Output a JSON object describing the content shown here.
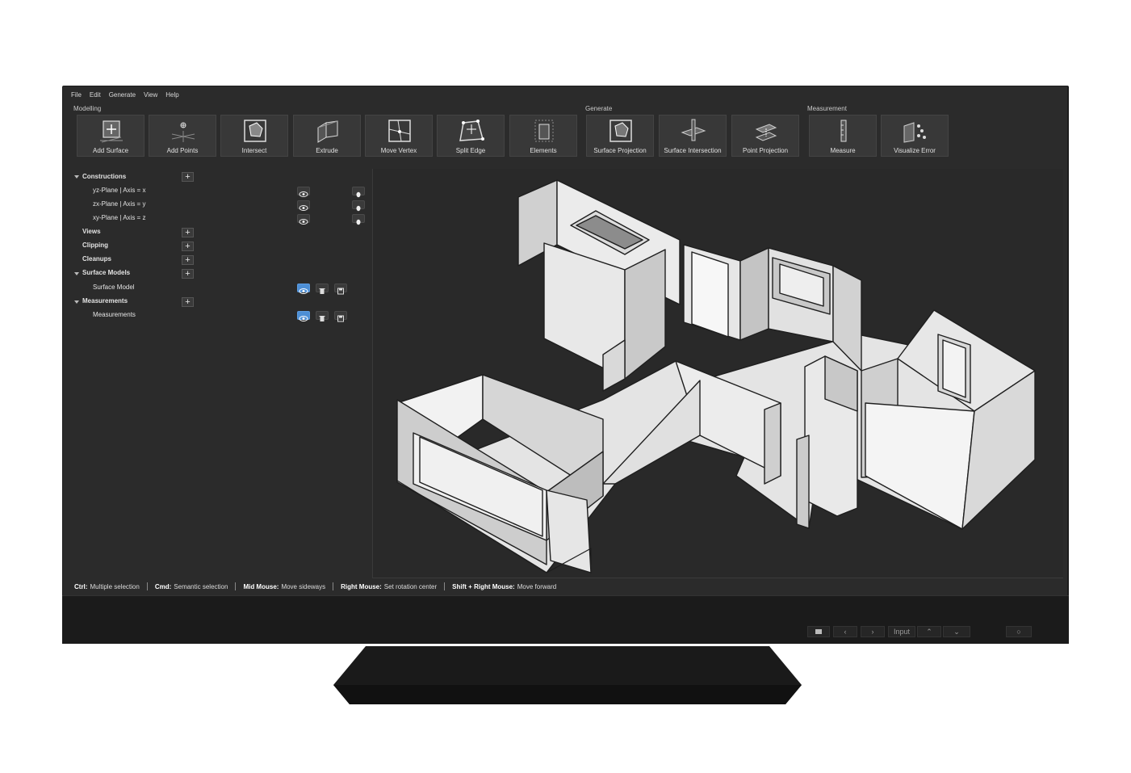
{
  "menu": [
    "File",
    "Edit",
    "Generate",
    "View",
    "Help"
  ],
  "ribbon": {
    "groups": [
      "Modelling",
      "Generate",
      "Measurement"
    ],
    "tools": [
      {
        "label": "Add Surface",
        "icon": "add-surface-icon"
      },
      {
        "label": "Add Points",
        "icon": "add-points-icon"
      },
      {
        "label": "Intersect",
        "icon": "intersect-icon"
      },
      {
        "label": "Extrude",
        "icon": "extrude-icon"
      },
      {
        "label": "Move Vertex",
        "icon": "move-vertex-icon"
      },
      {
        "label": "Split Edge",
        "icon": "split-edge-icon"
      },
      {
        "label": "Elements",
        "icon": "elements-icon"
      },
      {
        "label": "Surface Projection",
        "icon": "surface-projection-icon"
      },
      {
        "label": "Surface Intersection",
        "icon": "surface-intersection-icon"
      },
      {
        "label": "Point Projection",
        "icon": "point-projection-icon"
      },
      {
        "label": "Measure",
        "icon": "measure-icon"
      },
      {
        "label": "Visualize Error",
        "icon": "visualize-error-icon"
      }
    ]
  },
  "tree": {
    "constructions": "Constructions",
    "planes": [
      "yz-Plane | Axis = x",
      "zx-Plane | Axis = y",
      "xy-Plane | Axis = z"
    ],
    "views": "Views",
    "clipping": "Clipping",
    "cleanups": "Cleanups",
    "surface_models": "Surface Models",
    "surface_model": "Surface Model",
    "measurements": "Measurements",
    "measurements_item": "Measurements"
  },
  "status": [
    {
      "key": "Ctrl:",
      "text": "Multiple selection"
    },
    {
      "key": "Cmd:",
      "text": "Semantic selection"
    },
    {
      "key": "Mid Mouse:",
      "text": "Move sideways"
    },
    {
      "key": "Right Mouse:",
      "text": "Set rotation center"
    },
    {
      "key": "Shift + Right Mouse:",
      "text": "Move forward"
    }
  ],
  "monitor_controls": {
    "input_label": "Input"
  },
  "colors": {
    "active_toggle": "#4d8fd6",
    "background": "#2b2b2b"
  }
}
